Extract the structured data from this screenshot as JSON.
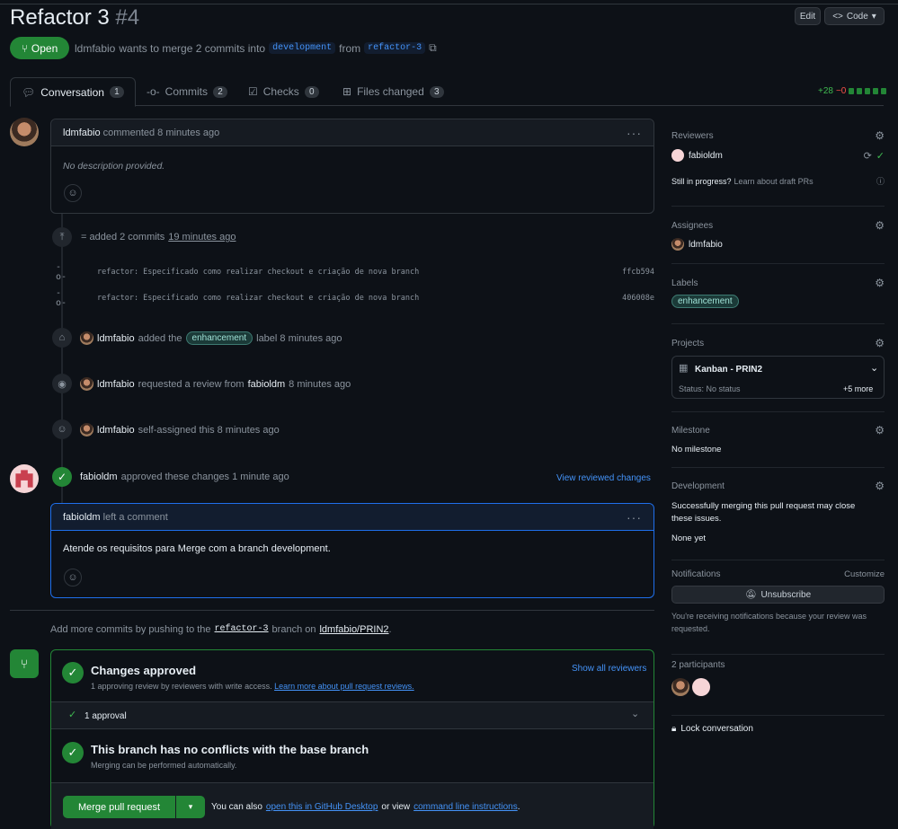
{
  "header": {
    "title": "Refactor 3",
    "number": "#4",
    "edit_label": "Edit",
    "code_label": "Code"
  },
  "status": {
    "label": "Open",
    "author": "ldmfabio",
    "text_mid": "wants to merge 2 commits into",
    "base_branch": "development",
    "from_text": "from",
    "head_branch": "refactor-3"
  },
  "tabs": [
    {
      "label": "Conversation",
      "count": "1"
    },
    {
      "label": "Commits",
      "count": "2"
    },
    {
      "label": "Checks",
      "count": "0"
    },
    {
      "label": "Files changed",
      "count": "3"
    }
  ],
  "diffstat": {
    "additions": "+28",
    "deletions": "−0"
  },
  "comment1": {
    "author": "ldmfabio",
    "meta": "commented 8 minutes ago",
    "body": "No description provided."
  },
  "timeline": {
    "commits_added_prefix": "= added 2 commits",
    "commits_added_time": "19 minutes ago",
    "commits": [
      {
        "message": "refactor: Especificado como realizar checkout e criação de nova branch",
        "sha": "ffcb594"
      },
      {
        "message": "refactor: Especificado como realizar checkout e criação de nova branch",
        "sha": "406008e"
      }
    ],
    "label_event": {
      "user": "ldmfabio",
      "pre": "added the",
      "label": "enhancement",
      "post": "label 8 minutes ago"
    },
    "review_event": {
      "user": "ldmfabio",
      "pre": "requested a review from",
      "target": "fabioldm",
      "post": "8 minutes ago"
    },
    "assign_event": {
      "user": "ldmfabio",
      "text": "self-assigned this 8 minutes ago"
    },
    "approve_event": {
      "user": "fabioldm",
      "text": "approved these changes 1 minute ago",
      "link": "View reviewed changes"
    }
  },
  "comment2": {
    "author": "fabioldm",
    "meta": "left a comment",
    "body": "Atende os requisitos para Merge com a branch development."
  },
  "push_hint": {
    "pre": "Add more commits by pushing to the",
    "branch": "refactor-3",
    "mid": "branch on",
    "repo": "ldmfabio/PRIN2",
    "end": "."
  },
  "merge": {
    "approved_title": "Changes approved",
    "approved_sub": "1 approving review by reviewers with write access.",
    "approved_link": "Learn more about pull request reviews.",
    "show_all": "Show all reviewers",
    "approval_count": "1 approval",
    "conflict_title": "This branch has no conflicts with the base branch",
    "conflict_sub": "Merging can be performed automatically.",
    "merge_btn": "Merge pull request",
    "also_pre": "You can also",
    "desktop_link": "open this in GitHub Desktop",
    "or_view": "or view",
    "cli_link": "command line instructions",
    "also_end": "."
  },
  "sidebar": {
    "reviewers": {
      "title": "Reviewers",
      "user": "fabioldm",
      "draft_text": "Still in progress?",
      "draft_link": "Learn about draft PRs"
    },
    "assignees": {
      "title": "Assignees",
      "user": "ldmfabio"
    },
    "labels": {
      "title": "Labels",
      "label": "enhancement"
    },
    "projects": {
      "title": "Projects",
      "name": "Kanban - PRIN2",
      "status": "Status: No status",
      "more": "+5 more"
    },
    "milestone": {
      "title": "Milestone",
      "value": "No milestone"
    },
    "development": {
      "title": "Development",
      "text": "Successfully merging this pull request may close these issues.",
      "value": "None yet"
    },
    "notifications": {
      "title": "Notifications",
      "customize": "Customize",
      "button": "Unsubscribe",
      "text": "You're receiving notifications because your review was requested."
    },
    "participants": {
      "title": "2 participants"
    },
    "lock": {
      "label": "Lock conversation"
    }
  },
  "colors": {
    "green": "#238636",
    "accent": "#4493f8",
    "danger": "#f85149"
  }
}
